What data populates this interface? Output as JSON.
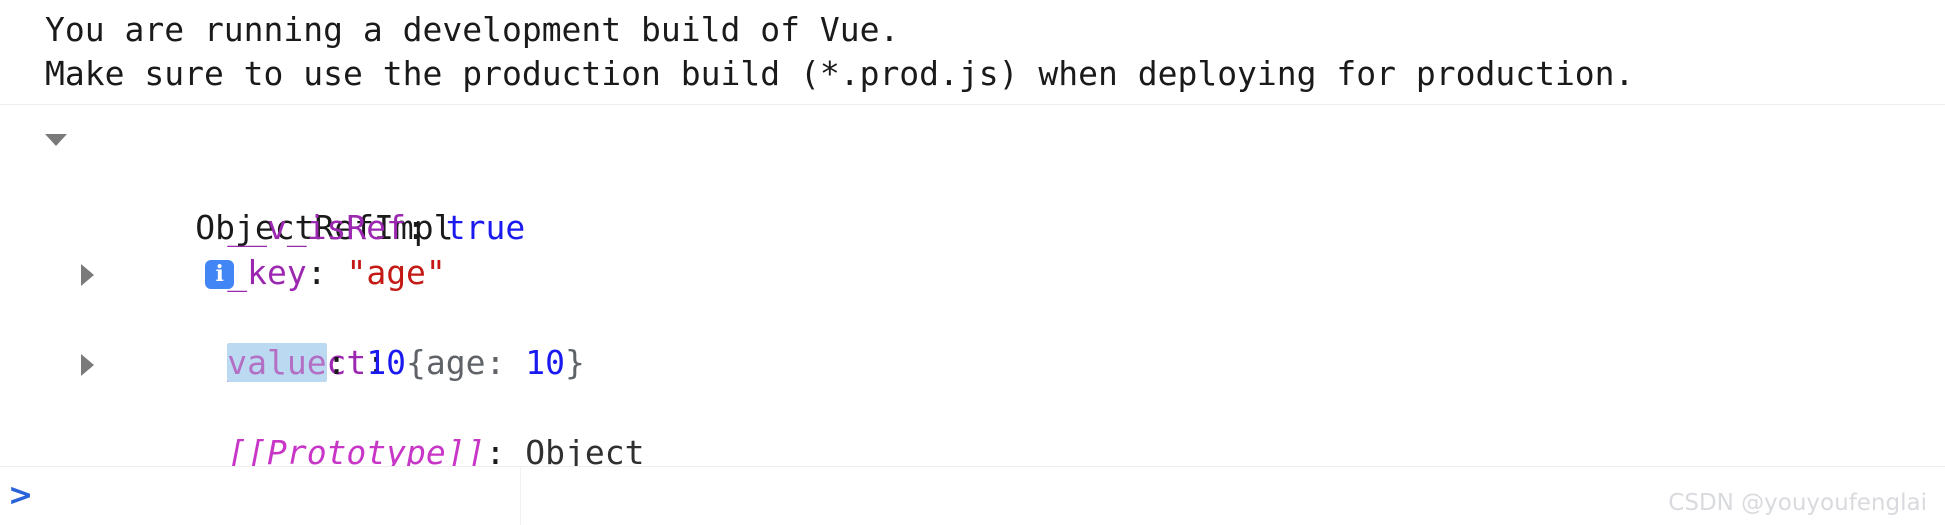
{
  "warning": {
    "line1": "You are running a development build of Vue.",
    "line2": "Make sure to use the production build (*.prod.js) when deploying for production."
  },
  "inspector": {
    "root": {
      "expander": "triangle-down",
      "class_name": "ObjectRefImpl",
      "info_badge": "i"
    },
    "properties": [
      {
        "expander": "none",
        "name": "__v_isRef",
        "separator": ": ",
        "value": "true",
        "value_kind": "boolean",
        "highlighted": false
      },
      {
        "expander": "none",
        "name": "_key",
        "separator": ": ",
        "value": "\"age\"",
        "value_kind": "string",
        "highlighted": false
      },
      {
        "expander": "triangle-right",
        "name": "_object",
        "separator": ": ",
        "value": "{age: 10}",
        "value_kind": "object-preview",
        "preview_prefix": "{age: ",
        "preview_number": "10",
        "preview_suffix": "}",
        "highlighted": false
      },
      {
        "expander": "none",
        "name": "value",
        "separator": ": ",
        "value": "10",
        "value_kind": "number",
        "highlighted": true
      },
      {
        "expander": "triangle-right",
        "name": "[[Prototype]]",
        "separator": ": ",
        "value": "Object",
        "value_kind": "object",
        "highlighted": false
      }
    ]
  },
  "prompt": {
    "caret": ">"
  },
  "watermark": {
    "text": "CSDN @youyoufenglai"
  },
  "colors": {
    "property": "#9c27b0",
    "prototype": "#c836c8",
    "string": "#c41a16",
    "number": "#1a1af0",
    "boolean": "#1a1af0",
    "highlight_bg": "#bcd9f2",
    "info_badge_bg": "#4285f4",
    "prompt_caret": "#2962d9",
    "watermark": "#d8dade"
  }
}
